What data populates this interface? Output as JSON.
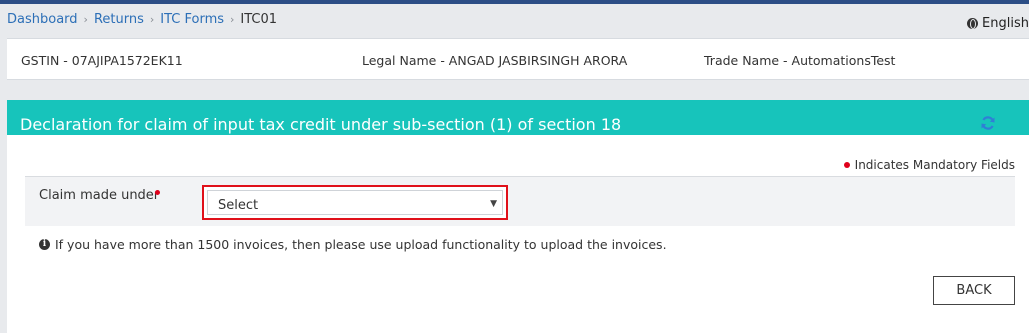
{
  "breadcrumb": {
    "items": [
      {
        "label": "Dashboard"
      },
      {
        "label": "Returns"
      },
      {
        "label": "ITC Forms"
      }
    ],
    "current": "ITC01"
  },
  "language": {
    "label": "English"
  },
  "taxpayer": {
    "gstin": "GSTIN - 07AJIPA1572EK11",
    "legal_name": "Legal Name - ANGAD JASBIRSINGH ARORA",
    "trade_name": "Trade Name - AutomationsTest"
  },
  "panel": {
    "title": "Declaration for claim of input tax credit under sub-section (1) of section 18",
    "mandatory_note": "Indicates Mandatory Fields",
    "claim_label": "Claim made under",
    "claim_select_value": "Select",
    "info_note": "If you have more than 1500 invoices, then please use upload functionality to upload the invoices.",
    "back_label": "BACK"
  },
  "colors": {
    "header_teal": "#17c4bb",
    "link_blue": "#2c6fb7",
    "highlight_red": "#e0101a",
    "mandatory_red": "#e0001b"
  },
  "icons": {
    "crumb_separator": "chevron-right-icon",
    "language": "globe-icon",
    "refresh": "refresh-icon",
    "info": "info-circle-icon",
    "select_caret": "caret-down-icon"
  }
}
